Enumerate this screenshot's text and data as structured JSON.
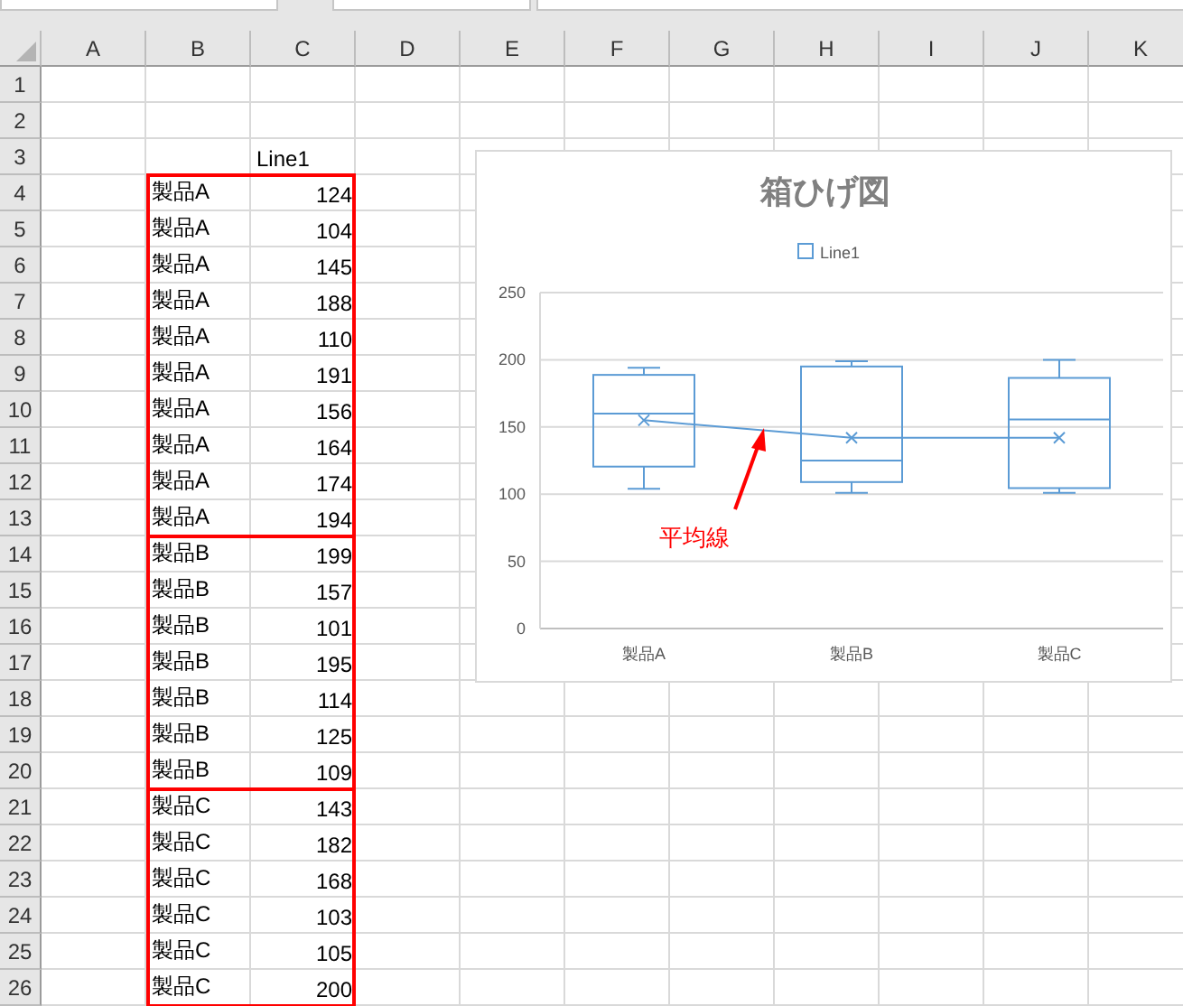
{
  "columns": [
    "A",
    "B",
    "C",
    "D",
    "E",
    "F",
    "G",
    "H",
    "I",
    "J",
    "K"
  ],
  "rows": [
    {
      "number": "1"
    },
    {
      "number": "2"
    },
    {
      "number": "3",
      "c": "Line1"
    },
    {
      "number": "4",
      "b": "製品A",
      "c": "124"
    },
    {
      "number": "5",
      "b": "製品A",
      "c": "104"
    },
    {
      "number": "6",
      "b": "製品A",
      "c": "145"
    },
    {
      "number": "7",
      "b": "製品A",
      "c": "188"
    },
    {
      "number": "8",
      "b": "製品A",
      "c": "110"
    },
    {
      "number": "9",
      "b": "製品A",
      "c": "191"
    },
    {
      "number": "10",
      "b": "製品A",
      "c": "156"
    },
    {
      "number": "11",
      "b": "製品A",
      "c": "164"
    },
    {
      "number": "12",
      "b": "製品A",
      "c": "174"
    },
    {
      "number": "13",
      "b": "製品A",
      "c": "194"
    },
    {
      "number": "14",
      "b": "製品B",
      "c": "199"
    },
    {
      "number": "15",
      "b": "製品B",
      "c": "157"
    },
    {
      "number": "16",
      "b": "製品B",
      "c": "101"
    },
    {
      "number": "17",
      "b": "製品B",
      "c": "195"
    },
    {
      "number": "18",
      "b": "製品B",
      "c": "114"
    },
    {
      "number": "19",
      "b": "製品B",
      "c": "125"
    },
    {
      "number": "20",
      "b": "製品B",
      "c": "109"
    },
    {
      "number": "21",
      "b": "製品C",
      "c": "143"
    },
    {
      "number": "22",
      "b": "製品C",
      "c": "182"
    },
    {
      "number": "23",
      "b": "製品C",
      "c": "168"
    },
    {
      "number": "24",
      "b": "製品C",
      "c": "103"
    },
    {
      "number": "25",
      "b": "製品C",
      "c": "105"
    },
    {
      "number": "26",
      "b": "製品C",
      "c": "200"
    }
  ],
  "chart": {
    "chart_data": {
      "type": "line",
      "title": "箱ひげ図",
      "categories": [
        "製品A",
        "製品B",
        "製品C"
      ],
      "series": [
        {
          "name": "Line1",
          "color": "#5b9bd5",
          "marker": "x",
          "values": [
            155,
            142,
            142
          ],
          "errors": [
            [
              104,
              194
            ],
            [
              101,
              199
            ],
            [
              101,
              200
            ]
          ]
        }
      ],
      "ylim": [
        0,
        250
      ],
      "yticks": [
        0,
        50,
        100,
        150,
        200,
        250
      ],
      "grid": true,
      "annotations": [
        {
          "text": "平均線"
        }
      ]
    }
  }
}
